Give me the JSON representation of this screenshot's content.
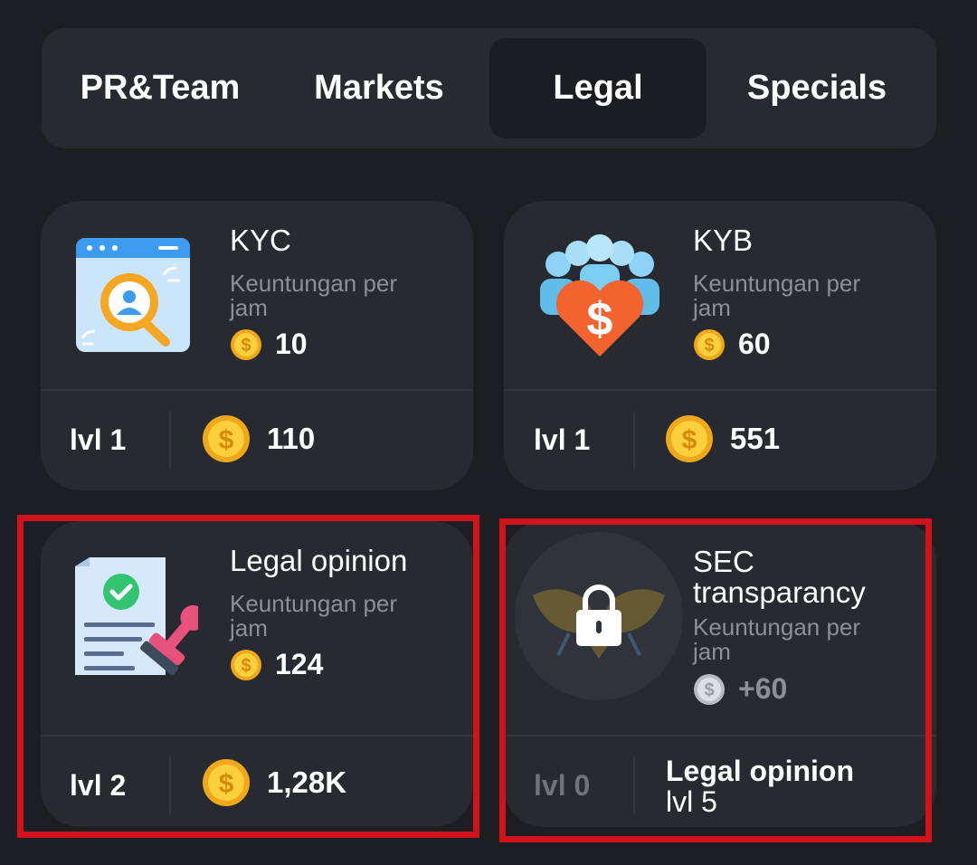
{
  "tabs": [
    {
      "label": "PR&Team",
      "active": false
    },
    {
      "label": "Markets",
      "active": false
    },
    {
      "label": "Legal",
      "active": true
    },
    {
      "label": "Specials",
      "active": false
    }
  ],
  "profit_label_line1": "Keuntungan per",
  "profit_label_line2": "jam",
  "cards": [
    {
      "title": "KYC",
      "profit": "10",
      "level": "lvl 1",
      "price": "110",
      "icon": "kyc-search-icon"
    },
    {
      "title": "KYB",
      "profit": "60",
      "level": "lvl 1",
      "price": "551",
      "icon": "team-heart-dollar-icon"
    },
    {
      "title": "Legal opinion",
      "profit": "124",
      "level": "lvl 2",
      "price": "1,28K",
      "icon": "document-stamp-icon",
      "highlighted": true
    },
    {
      "title_line1": "SEC",
      "title_line2": "transparancy",
      "profit": "+60",
      "level": "lvl 0",
      "locked": true,
      "requirement": {
        "title": "Legal opinion",
        "level": "lvl 5"
      },
      "icon": "lock-icon",
      "highlighted": true
    }
  ],
  "colors": {
    "highlight": "#d0121b",
    "coin": "#f7c31f",
    "card_bg": "#272a31",
    "page_bg": "#1c1e22"
  }
}
